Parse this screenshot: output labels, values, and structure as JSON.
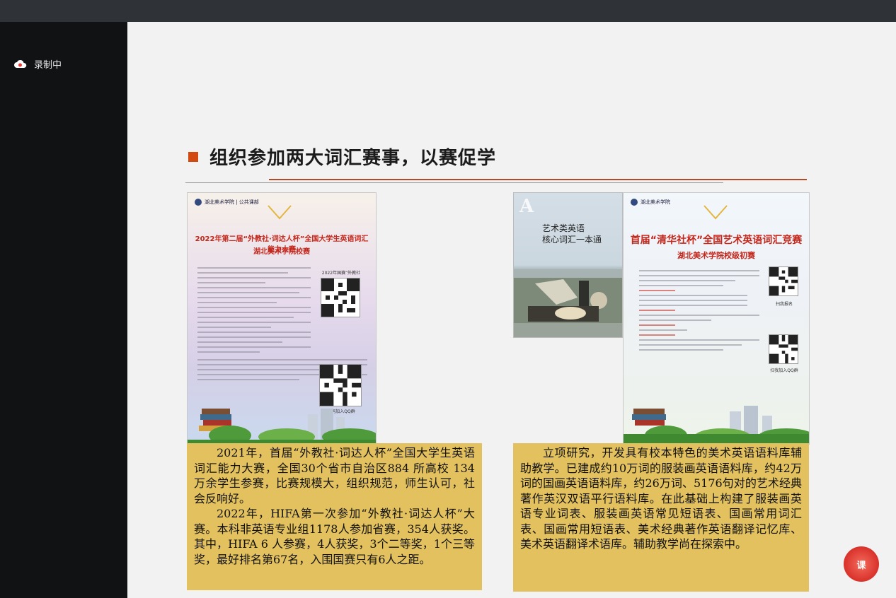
{
  "recording": {
    "label": "录制中"
  },
  "slide": {
    "title": "组织参加两大词汇赛事，以赛促学",
    "poster_left": {
      "school": "湖北美术学院 | 公共课部",
      "title": "2022年第二届“外教社·词达人杯”全国大学生英语词汇能力大赛",
      "subtitle": "湖北美术学院校赛",
      "qr1_label": "2022年国赛“外教社",
      "qr2_label": "扫码加入QQ群"
    },
    "book": {
      "letter": "A",
      "title_line1": "艺术类英语",
      "title_line2": "核心词汇一本通"
    },
    "poster_right": {
      "school": "湖北美术学院",
      "title": "首届“清华社杯”全国艺术英语词汇竞赛",
      "subtitle": "湖北美术学院校级初赛",
      "qr1_label": "扫我报名",
      "qr2_label": "扫我加入QQ群"
    },
    "caption_left": {
      "p1": "2021年，首届“外教社·词达人杯”全国大学生英语词汇能力大赛，全国30个省市自治区884 所高校 134 万余学生参赛，比赛规模大，组织规范，师生认可，社会反响好。",
      "p2": "2022年，HIFA第一次参加“外教社·词达人杯”大赛。本科非英语专业组1178人参加省赛，354人获奖。其中，HIFA 6 人参赛，4人获奖，3个二等奖，1个三等奖，最好排名第67名，入围国赛只有6人之距。"
    },
    "caption_right": {
      "p1": "立项研究，开发具有校本特色的美术英语语料库辅助教学。已建成约10万词的服装画英语语料库，约42万词的国画英语语料库，约26万词、5176句对的艺术经典著作英汉双语平行语料库。在此基础上构建了服装画英语专业词表、服装画英语常见短语表、国画常用词汇表、国画常用短语表、美术经典著作英语翻译记忆库、美术英语翻译术语库。辅助教学尚在探索中。"
    },
    "seal_text": "课"
  },
  "colors": {
    "accent": "#d24a10",
    "caption_bg": "#e2c15e",
    "poster_red": "#c4271c"
  }
}
